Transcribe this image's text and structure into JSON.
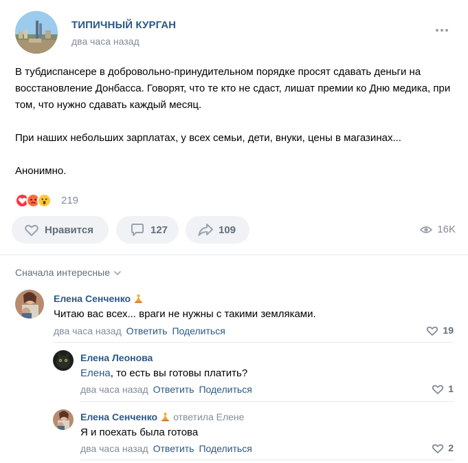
{
  "post": {
    "group_name": "ТИПИЧНЫЙ КУРГАН",
    "time": "два часа назад",
    "paragraphs": [
      "В тубдиспансере в добровольно-принудительном порядке просят сдавать деньги на восстановление Донбасса. Говорят, что те кто не сдаст, лишат премии ко Дню медика, при том, что нужно сдавать каждый месяц.",
      "При наших небольших зарплатах, у всех семьи, дети, внуки, цены в магазинах...",
      "Анонимно."
    ],
    "reactions_count": "219",
    "like_label": "Нравится",
    "comments_count": "127",
    "shares_count": "109",
    "views": "16K"
  },
  "comments_section": {
    "sort_label": "Сначала интересные"
  },
  "comments": [
    {
      "author": "Елена Сенченко",
      "text": "Читаю вас всех... враги не нужны с такими земляками.",
      "time": "два часа назад",
      "reply_label": "Ответить",
      "share_label": "Поделиться",
      "likes": "19"
    },
    {
      "author": "Елена Леонова",
      "mention": "Елена",
      "text": ", то есть вы готовы платить?",
      "time": "два часа назад",
      "reply_label": "Ответить",
      "share_label": "Поделиться",
      "likes": "1"
    },
    {
      "author": "Елена Сенченко",
      "replied_to": "ответила Елене",
      "text": "Я и поехать была готова",
      "time": "два часа назад",
      "reply_label": "Ответить",
      "share_label": "Поделиться",
      "likes": "2"
    }
  ],
  "colors": {
    "link": "#2a5885",
    "secondary_text": "#818c99",
    "button_bg": "#f0f2f5",
    "heart_reaction": "#ff3347"
  },
  "icons": [
    "more-icon",
    "heart-icon",
    "comment-icon",
    "share-icon",
    "eye-icon",
    "chevron-down-icon",
    "prayer-badge-icon"
  ]
}
